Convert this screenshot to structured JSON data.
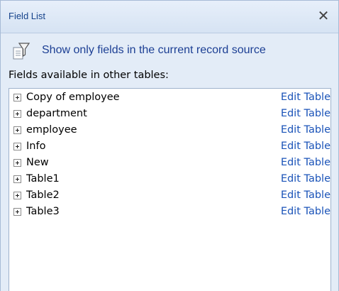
{
  "pane": {
    "title": "Field List",
    "close_glyph": "✕",
    "close_icon": "close-icon"
  },
  "option": {
    "icon": "filter-record-source-icon",
    "label": "Show only fields in the current record source"
  },
  "section": {
    "label": "Fields available in other tables:"
  },
  "tables": [
    {
      "name": "Copy of employee",
      "action": "Edit Table"
    },
    {
      "name": "department",
      "action": "Edit Table"
    },
    {
      "name": "employee",
      "action": "Edit Table"
    },
    {
      "name": "Info",
      "action": "Edit Table"
    },
    {
      "name": "New",
      "action": "Edit Table"
    },
    {
      "name": "Table1",
      "action": "Edit Table"
    },
    {
      "name": "Table2",
      "action": "Edit Table"
    },
    {
      "name": "Table3",
      "action": "Edit Table"
    }
  ],
  "colors": {
    "link": "#1a53b8",
    "title": "#15428b",
    "pane_background": "#e3ecf7"
  }
}
